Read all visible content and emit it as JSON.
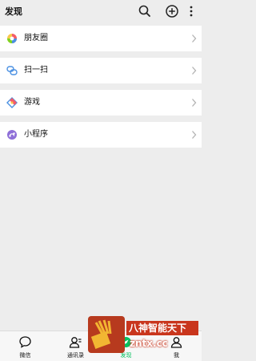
{
  "header": {
    "title": "发现",
    "icons": [
      "search-icon",
      "plus-circle-icon",
      "more-vertical-icon"
    ]
  },
  "groups": [
    {
      "items": [
        {
          "label": "朋友圈",
          "icon": "moments-icon"
        }
      ]
    },
    {
      "items": [
        {
          "label": "扫一扫",
          "icon": "scan-icon"
        }
      ]
    },
    {
      "items": [
        {
          "label": "游戏",
          "icon": "game-icon"
        }
      ]
    },
    {
      "items": [
        {
          "label": "小程序",
          "icon": "mini-program-icon"
        }
      ]
    }
  ],
  "tabbar": {
    "tabs": [
      {
        "label": "微信",
        "icon": "chat-bubble-icon",
        "active": false
      },
      {
        "label": "通讯录",
        "icon": "contacts-icon",
        "active": false
      },
      {
        "label": "发现",
        "icon": "compass-icon",
        "active": true
      },
      {
        "label": "我",
        "icon": "person-icon",
        "active": false
      }
    ],
    "active_color": "#07c160"
  },
  "watermark": {
    "line1": "八神智能天下",
    "line2": "zntx.cc"
  },
  "colors": {
    "background": "#ededed",
    "card": "#ffffff",
    "accent": "#07c160",
    "watermark_red": "#c9361d"
  }
}
